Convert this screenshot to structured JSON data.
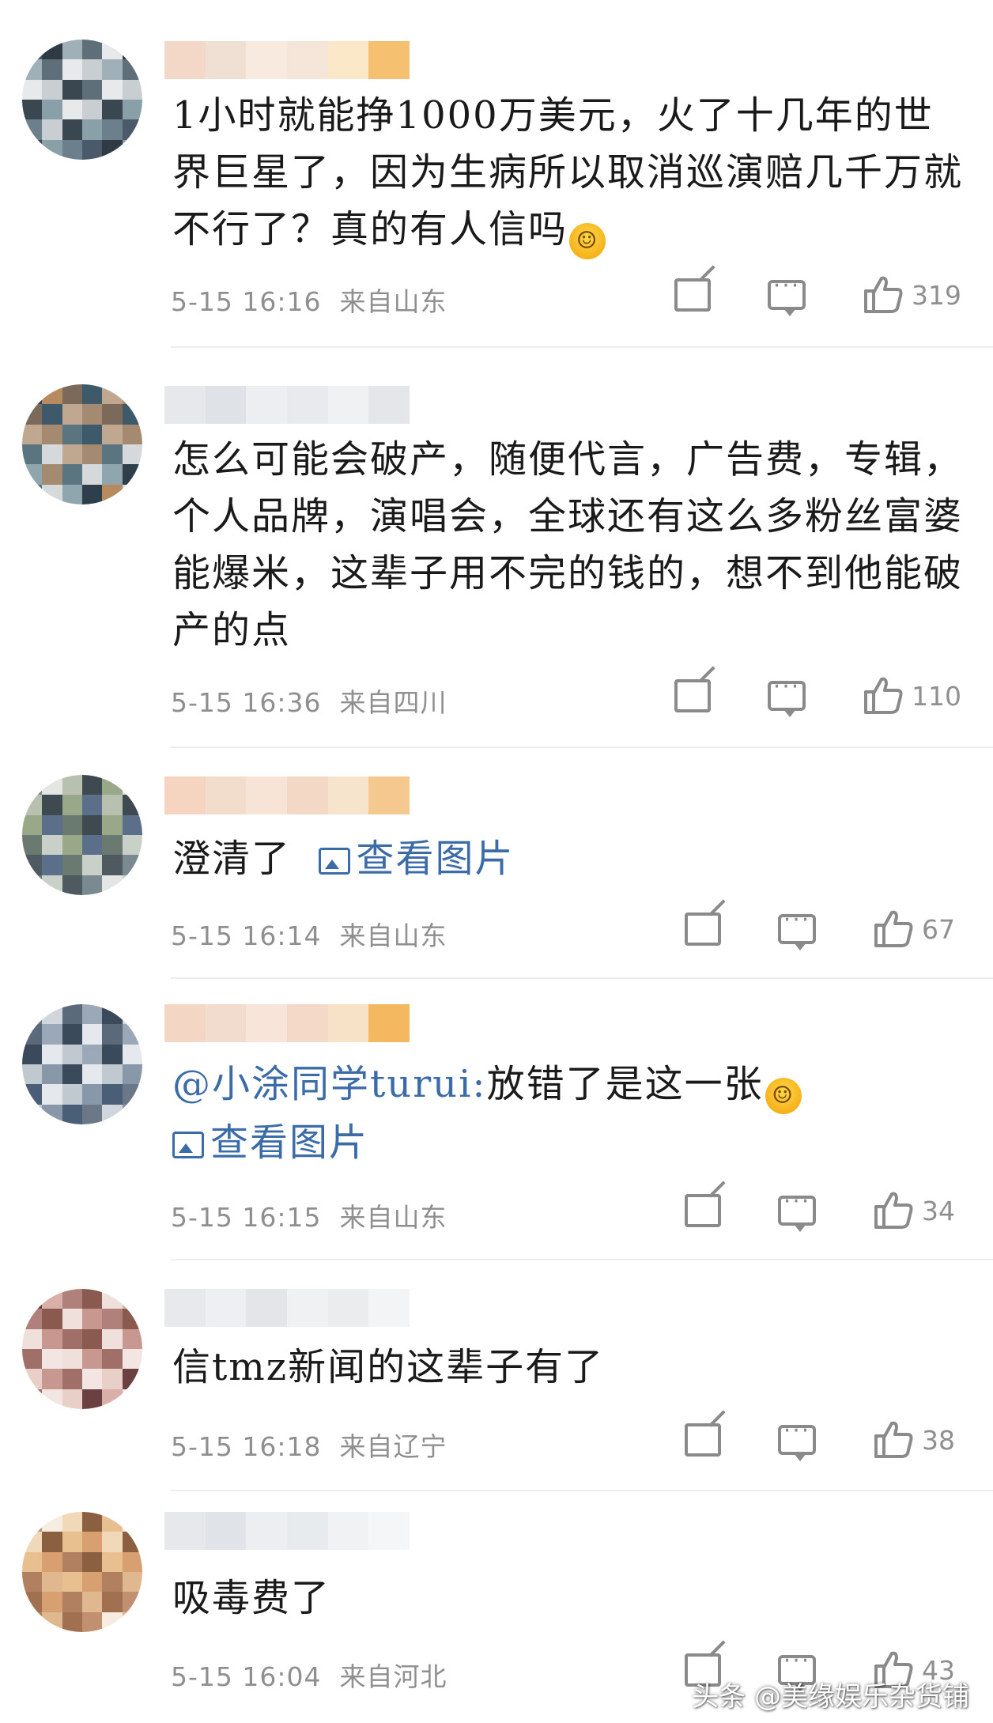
{
  "comments": [
    {
      "text": "1小时就能挣1000万美元，火了十几年的世界巨星了，因为生病所以取消巡演赔几千万就不行了？真的有人信吗",
      "emoji": "laugh-cry",
      "time": "5-15 16:16",
      "location": "来自山东",
      "likes": "319"
    },
    {
      "text": "怎么可能会破产，随便代言，广告费，专辑，个人品牌，演唱会，全球还有这么多粉丝富婆能爆米，这辈子用不完的钱的，想不到他能破产的点",
      "time": "5-15 16:36",
      "location": "来自四川",
      "likes": "110"
    },
    {
      "text": "澄清了",
      "link": "查看图片",
      "time": "5-15 16:14",
      "location": "来自山东",
      "likes": "67"
    },
    {
      "mention": "@小涂同学turui:",
      "text": "放错了是这一张",
      "emoji": "laugh-cry",
      "link": "查看图片",
      "time": "5-15 16:15",
      "location": "来自山东",
      "likes": "34"
    },
    {
      "text": "信tmz新闻的这辈子有了",
      "time": "5-15 16:18",
      "location": "来自辽宁",
      "likes": "38"
    },
    {
      "text": "吸毒费了",
      "time": "5-15 16:04",
      "location": "来自河北",
      "likes": "43"
    }
  ],
  "watermark": "头条 @美缘娱乐杂货铺",
  "colors": {
    "link": "#3c6ca8",
    "meta": "#8f8f8f",
    "text": "#1a1a1a"
  }
}
